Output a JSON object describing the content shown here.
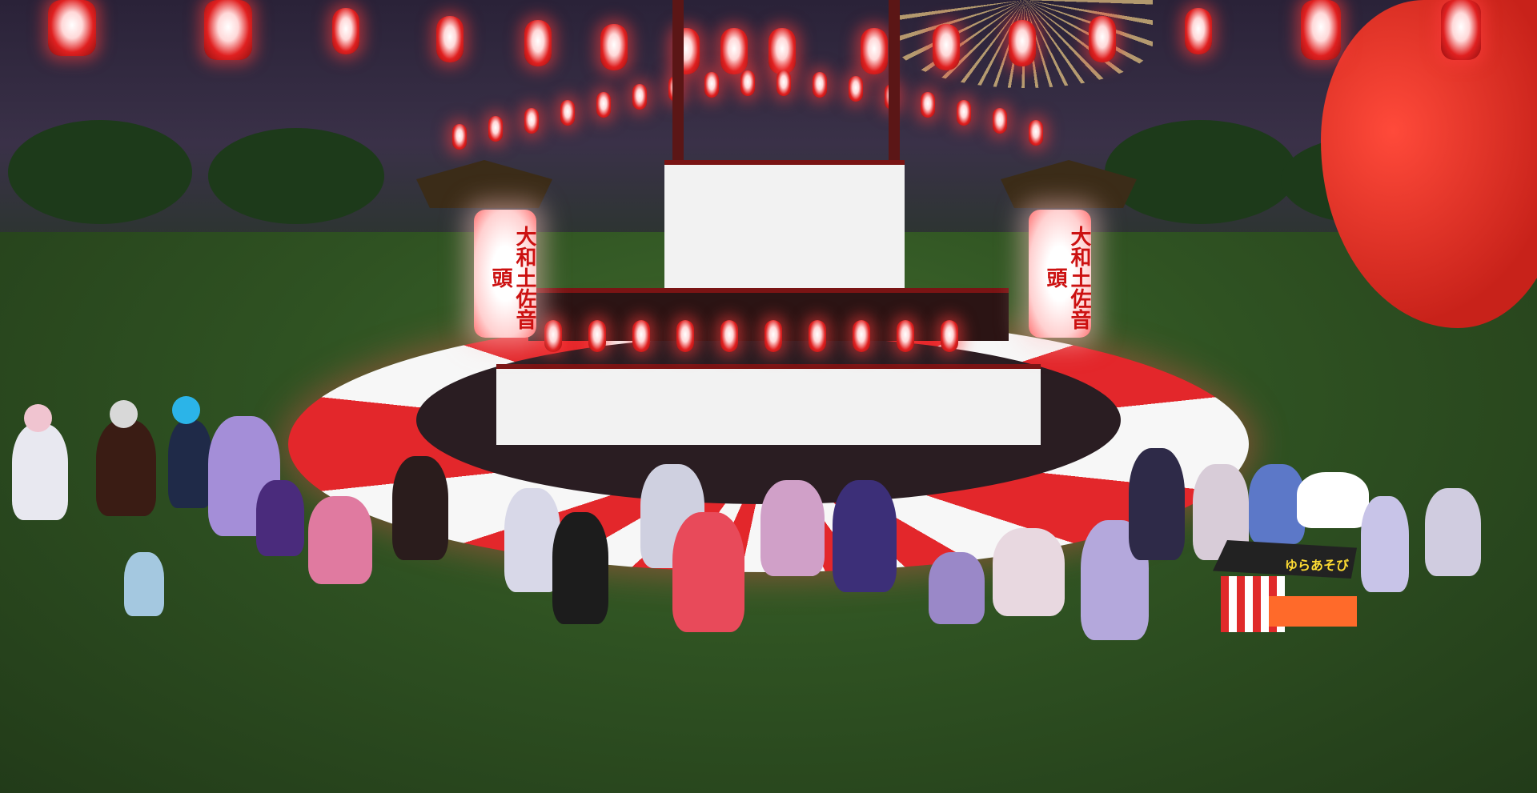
{
  "scene": {
    "type": "game-world-screenshot",
    "setting": "night summer festival (bon odori) plaza with yagura stage",
    "stage_tower_text_left": "大和土佐音頭",
    "stage_tower_text_right": "大和土佐音頭",
    "booth_sign": "ゆらあそび"
  },
  "colors": {
    "lantern_red": "#e02020",
    "ring_red": "#e3272b",
    "ring_white": "#f7f7f7",
    "grass": "#2f5222",
    "sky": "#2a2238"
  }
}
